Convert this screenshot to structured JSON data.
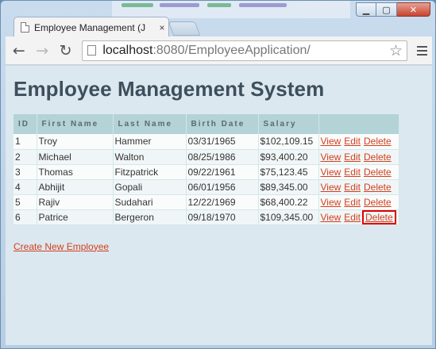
{
  "browser": {
    "tab_title": "Employee Management (J",
    "tab_close": "×",
    "url_host": "localhost",
    "url_rest": ":8080/EmployeeApplication/",
    "back_glyph": "←",
    "forward_glyph": "→",
    "reload_glyph": "↻",
    "star_glyph": "☆",
    "caption": {
      "minimize": "▁",
      "maximize": "▢",
      "close": "✕"
    }
  },
  "page": {
    "heading": "Employee Management System",
    "columns": [
      "ID",
      "First Name",
      "Last Name",
      "Birth Date",
      "Salary",
      ""
    ],
    "rows": [
      {
        "id": "1",
        "first": "Troy",
        "last": "Hammer",
        "birth": "03/31/1965",
        "salary": "$102,109.15"
      },
      {
        "id": "2",
        "first": "Michael",
        "last": "Walton",
        "birth": "08/25/1986",
        "salary": "$93,400.20"
      },
      {
        "id": "3",
        "first": "Thomas",
        "last": "Fitzpatrick",
        "birth": "09/22/1961",
        "salary": "$75,123.45"
      },
      {
        "id": "4",
        "first": "Abhijit",
        "last": "Gopali",
        "birth": "06/01/1956",
        "salary": "$89,345.00"
      },
      {
        "id": "5",
        "first": "Rajiv",
        "last": "Sudahari",
        "birth": "12/22/1969",
        "salary": "$68,400.22"
      },
      {
        "id": "6",
        "first": "Patrice",
        "last": "Bergeron",
        "birth": "09/18/1970",
        "salary": "$109,345.00"
      }
    ],
    "actions": {
      "view": "View",
      "edit": "Edit",
      "delete": "Delete"
    },
    "create_link": "Create New Employee"
  }
}
